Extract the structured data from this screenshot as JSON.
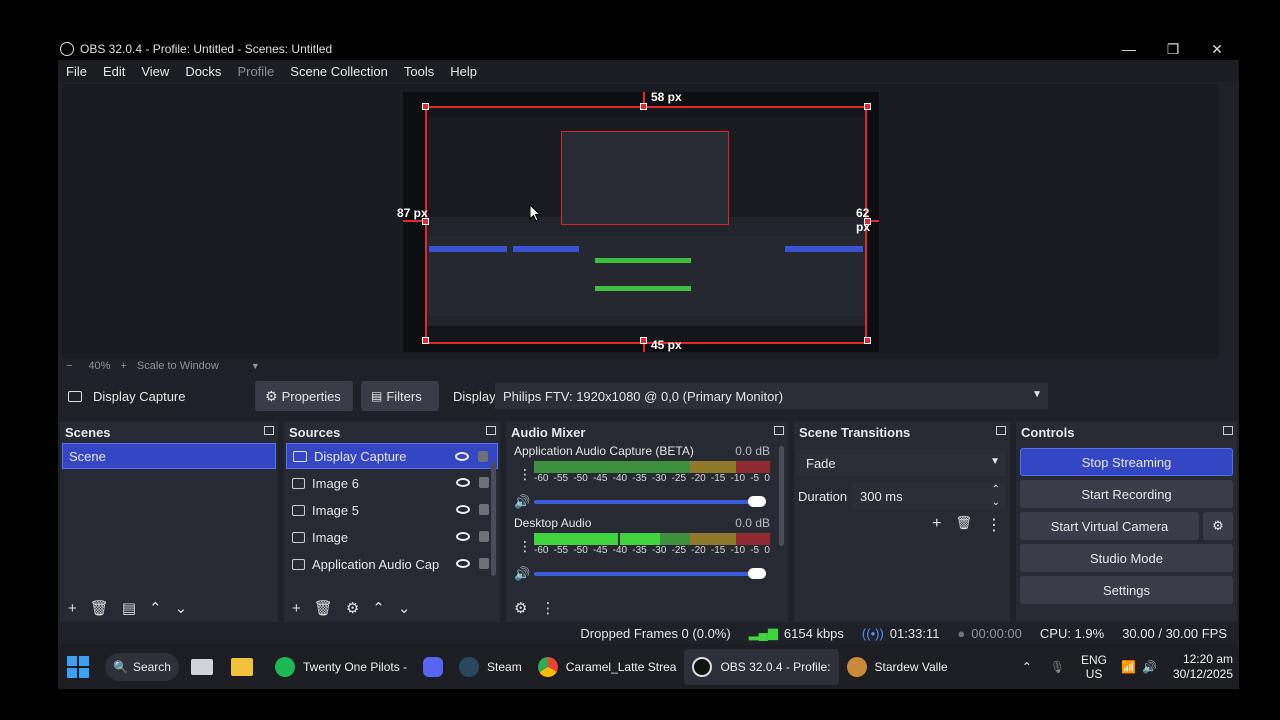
{
  "window": {
    "title": "OBS 32.0.4 - Profile: Untitled - Scenes: Untitled",
    "minimize": "—",
    "maximize": "❐",
    "close": "✕"
  },
  "menu": [
    "File",
    "Edit",
    "View",
    "Docks",
    "Profile",
    "Scene Collection",
    "Tools",
    "Help"
  ],
  "preview": {
    "top_px": "58 px",
    "left_px": "87 px",
    "right_px": "62 px",
    "bottom_px": "45 px",
    "zoom_minus": "−",
    "zoom": "40%",
    "zoom_plus": "+",
    "scale_mode": "Scale to Window"
  },
  "context": {
    "source_name": "Display Capture",
    "properties_label": "Properties",
    "filters_label": "Filters",
    "display_label": "Display",
    "display_value": "Philips FTV: 1920x1080 @ 0,0 (Primary Monitor)"
  },
  "scenes": {
    "title": "Scenes",
    "items": [
      "Scene"
    ]
  },
  "sources": {
    "title": "Sources",
    "items": [
      "Display Capture",
      "Image 6",
      "Image 5",
      "Image",
      "Application Audio Cap"
    ]
  },
  "mixer": {
    "title": "Audio Mixer",
    "tracks": [
      {
        "name": "Application Audio Capture (BETA)",
        "db": "0.0 dB",
        "level": 0.62
      },
      {
        "name": "Desktop Audio",
        "db": "0.0 dB",
        "level": 0.55
      }
    ],
    "ticks": [
      "-60",
      "-55",
      "-50",
      "-45",
      "-40",
      "-35",
      "-30",
      "-25",
      "-20",
      "-15",
      "-10",
      "-5",
      "0"
    ]
  },
  "transitions": {
    "title": "Scene Transitions",
    "selected": "Fade",
    "duration_label": "Duration",
    "duration_value": "300 ms"
  },
  "controls": {
    "title": "Controls",
    "stop_streaming": "Stop Streaming",
    "start_recording": "Start Recording",
    "start_virtual_camera": "Start Virtual Camera",
    "studio_mode": "Studio Mode",
    "settings": "Settings"
  },
  "status": {
    "dropped": "Dropped Frames 0 (0.0%)",
    "bitrate": "6154 kbps",
    "stream_time": "01:33:11",
    "rec_time": "00:00:00",
    "cpu": "CPU: 1.9%",
    "fps": "30.00 / 30.00 FPS"
  },
  "taskbar": {
    "search": "Search",
    "apps": [
      {
        "label": "Twenty One Pilots -",
        "color": "#1db954"
      },
      {
        "label": "",
        "color": "#5865f2"
      },
      {
        "label": "Steam",
        "color": "#1b2838"
      },
      {
        "label": "Caramel_Latte Strea",
        "color": "#e8a33b"
      },
      {
        "label": "OBS 32.0.4 - Profile:",
        "color": "#222222"
      },
      {
        "label": "Stardew Valle",
        "color": "#c98a3a"
      }
    ],
    "lang": "ENG",
    "region": "US",
    "time": "12:20 am",
    "date": "30/12/2025"
  }
}
